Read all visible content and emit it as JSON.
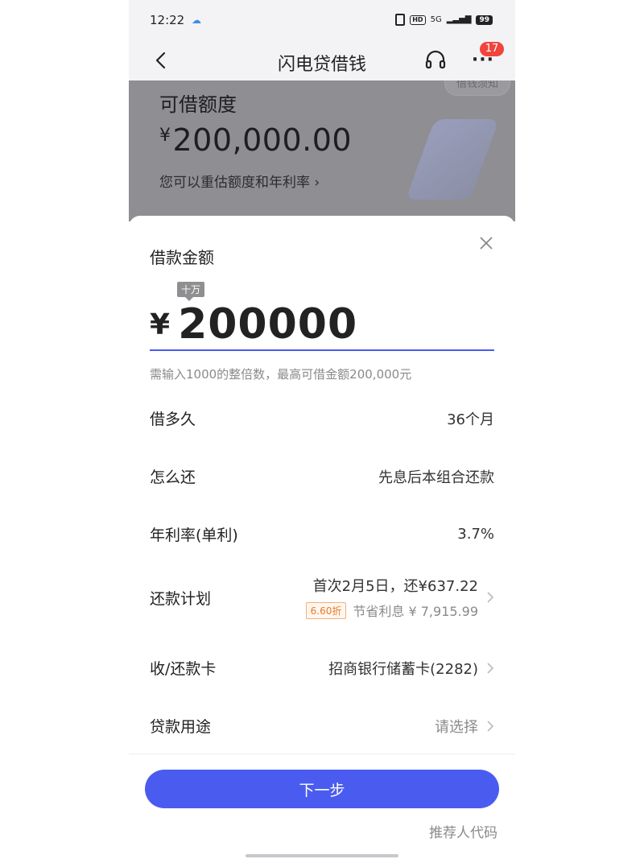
{
  "status_bar": {
    "time": "12:22",
    "network": "5G",
    "hd": "HD",
    "battery": "99"
  },
  "nav": {
    "title": "闪电贷借钱",
    "badge_count": "17"
  },
  "hero": {
    "tip": "借钱须知",
    "label": "可借额度",
    "currency": "¥",
    "amount": "200,000.00",
    "note": "您可以重估额度和年利率 ›"
  },
  "sheet": {
    "title": "借款金额",
    "unit_tip": "十万",
    "currency": "¥",
    "amount_value": "200000",
    "hint": "需输入1000的整倍数，最高可借金额200,000元",
    "rows": [
      {
        "label": "借多久",
        "value": "36个月"
      },
      {
        "label": "怎么还",
        "value": "先息后本组合还款"
      },
      {
        "label": "年利率(单利)",
        "value": "3.7%"
      }
    ],
    "plan": {
      "label": "还款计划",
      "main": "首次2月5日，还¥637.22",
      "discount": "6.60折",
      "saving": "节省利息 ¥ 7,915.99"
    },
    "card": {
      "label": "收/还款卡",
      "value": "招商银行储蓄卡(2282)"
    },
    "purpose": {
      "label": "贷款用途",
      "value": "请选择"
    },
    "next_label": "下一步",
    "referral_label": "推荐人代码"
  },
  "colors": {
    "primary": "#4a5cf0",
    "badge": "#f0443c",
    "discount": "#e87d2a"
  },
  "icons": [
    "back-icon",
    "headset-icon",
    "more-icon",
    "close-icon",
    "chevron-right-icon"
  ]
}
